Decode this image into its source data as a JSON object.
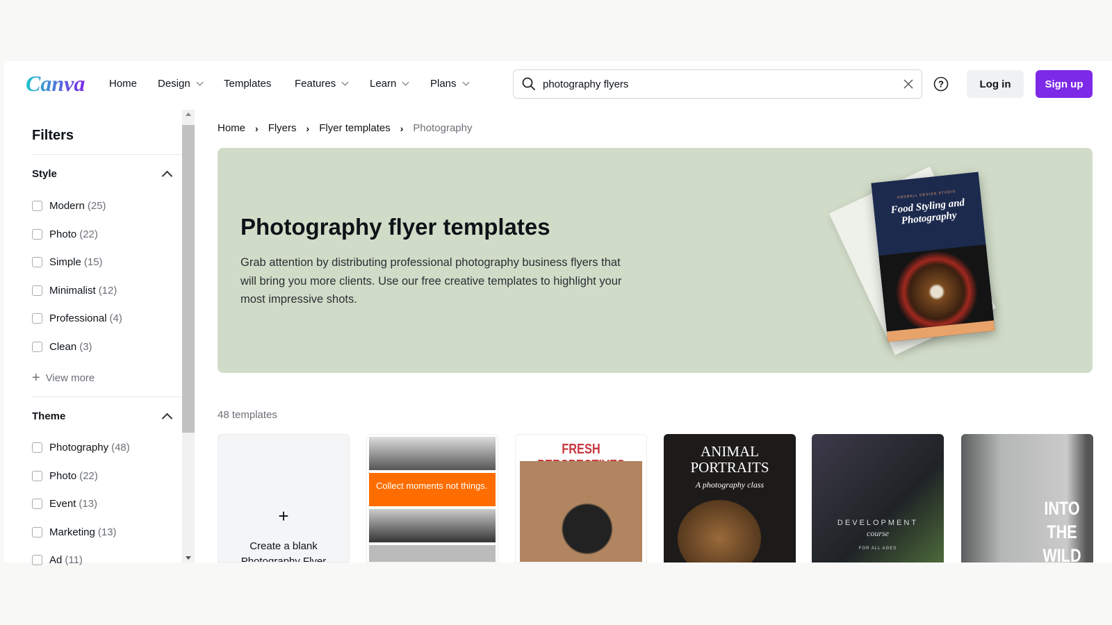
{
  "header": {
    "logo": "Canva",
    "nav": [
      {
        "label": "Home",
        "dropdown": false
      },
      {
        "label": "Design",
        "dropdown": true
      },
      {
        "label": "Templates",
        "dropdown": false
      },
      {
        "label": "Features",
        "dropdown": true
      },
      {
        "label": "Learn",
        "dropdown": true
      },
      {
        "label": "Plans",
        "dropdown": true
      }
    ],
    "search_value": "photography flyers",
    "login": "Log in",
    "signup": "Sign up",
    "brand_color": "#7d2ae8"
  },
  "sidebar": {
    "title": "Filters",
    "style": {
      "label": "Style",
      "items": [
        {
          "label": "Modern",
          "count": "(25)"
        },
        {
          "label": "Photo",
          "count": "(22)"
        },
        {
          "label": "Simple",
          "count": "(15)"
        },
        {
          "label": "Minimalist",
          "count": "(12)"
        },
        {
          "label": "Professional",
          "count": "(4)"
        },
        {
          "label": "Clean",
          "count": "(3)"
        }
      ],
      "view_more": "View more"
    },
    "theme": {
      "label": "Theme",
      "items": [
        {
          "label": "Photography",
          "count": "(48)"
        },
        {
          "label": "Photo",
          "count": "(22)"
        },
        {
          "label": "Event",
          "count": "(13)"
        },
        {
          "label": "Marketing",
          "count": "(13)"
        },
        {
          "label": "Ad",
          "count": "(11)"
        }
      ]
    }
  },
  "breadcrumb": [
    "Home",
    "Flyers",
    "Flyer templates",
    "Photography"
  ],
  "banner": {
    "title": "Photography flyer templates",
    "description": "Grab attention by distributing professional photography business flyers that will bring you more clients. Use our free creative templates to highlight your most impressive shots.",
    "flyer": {
      "studio": "ODDBALL DESIGN STUDIO",
      "title": "Food Styling and Photography"
    }
  },
  "count": "48 templates",
  "cards": {
    "blank": "Create a blank Photography Flyer",
    "c1": "Collect moments not things.",
    "c2": "FRESH PERSPECTIVES",
    "c3_title": "ANIMAL PORTRAITS",
    "c3_sub": "A photography class",
    "c4_title": "DEVELOPMENT",
    "c4_sub": "course",
    "c4_small": "FOR ALL AGES",
    "c5": "INTO THE WILD"
  }
}
